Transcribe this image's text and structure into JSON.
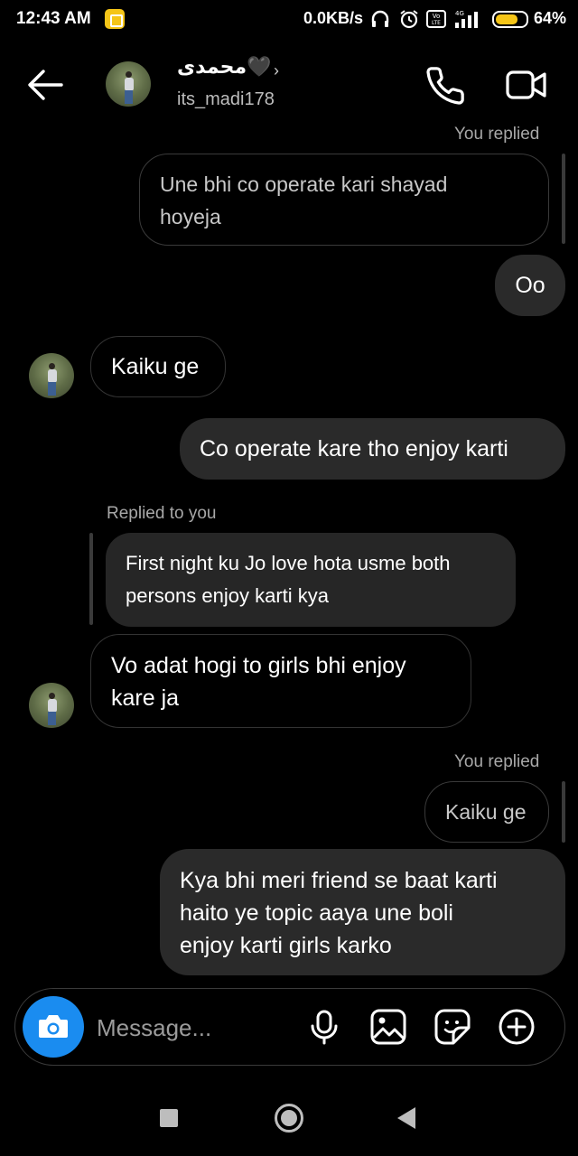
{
  "status_bar": {
    "time": "12:43 AM",
    "network_speed": "0.0KB/s",
    "battery_percent": "64%",
    "signal_label": "4G"
  },
  "header": {
    "display_name": "محمدی🖤",
    "username": "its_madi178",
    "chevron": "›"
  },
  "messages": {
    "reply_meta_1": "You replied",
    "reply_quote_1": [
      "Une bhi co operate kari shayad",
      "hoyeja"
    ],
    "sent_1": "Oo",
    "recv_1": "Kaiku ge",
    "sent_2": "Co operate kare tho enjoy karti",
    "replied_to_you_meta": "Replied to you",
    "quoted_2": [
      "First night ku Jo love hota usme both",
      "persons enjoy karti kya"
    ],
    "recv_2": [
      "Vo adat hogi to girls bhi enjoy",
      "kare ja"
    ],
    "reply_meta_2": "You replied",
    "reply_quote_2": "Kaiku ge",
    "sent_3": [
      "Kya bhi meri friend se baat karti",
      "haito ye topic aaya une boli",
      "enjoy karti girls karko"
    ]
  },
  "composer": {
    "placeholder": "Message..."
  },
  "colors": {
    "background": "#000000",
    "sent_bubble": "#2a2a2a",
    "camera_button": "#1a8cf0",
    "battery": "#f5c518"
  },
  "icons": [
    "back-arrow-icon",
    "phone-icon",
    "video-camera-icon",
    "camera-icon",
    "microphone-icon",
    "gallery-icon",
    "sticker-icon",
    "plus-icon"
  ]
}
